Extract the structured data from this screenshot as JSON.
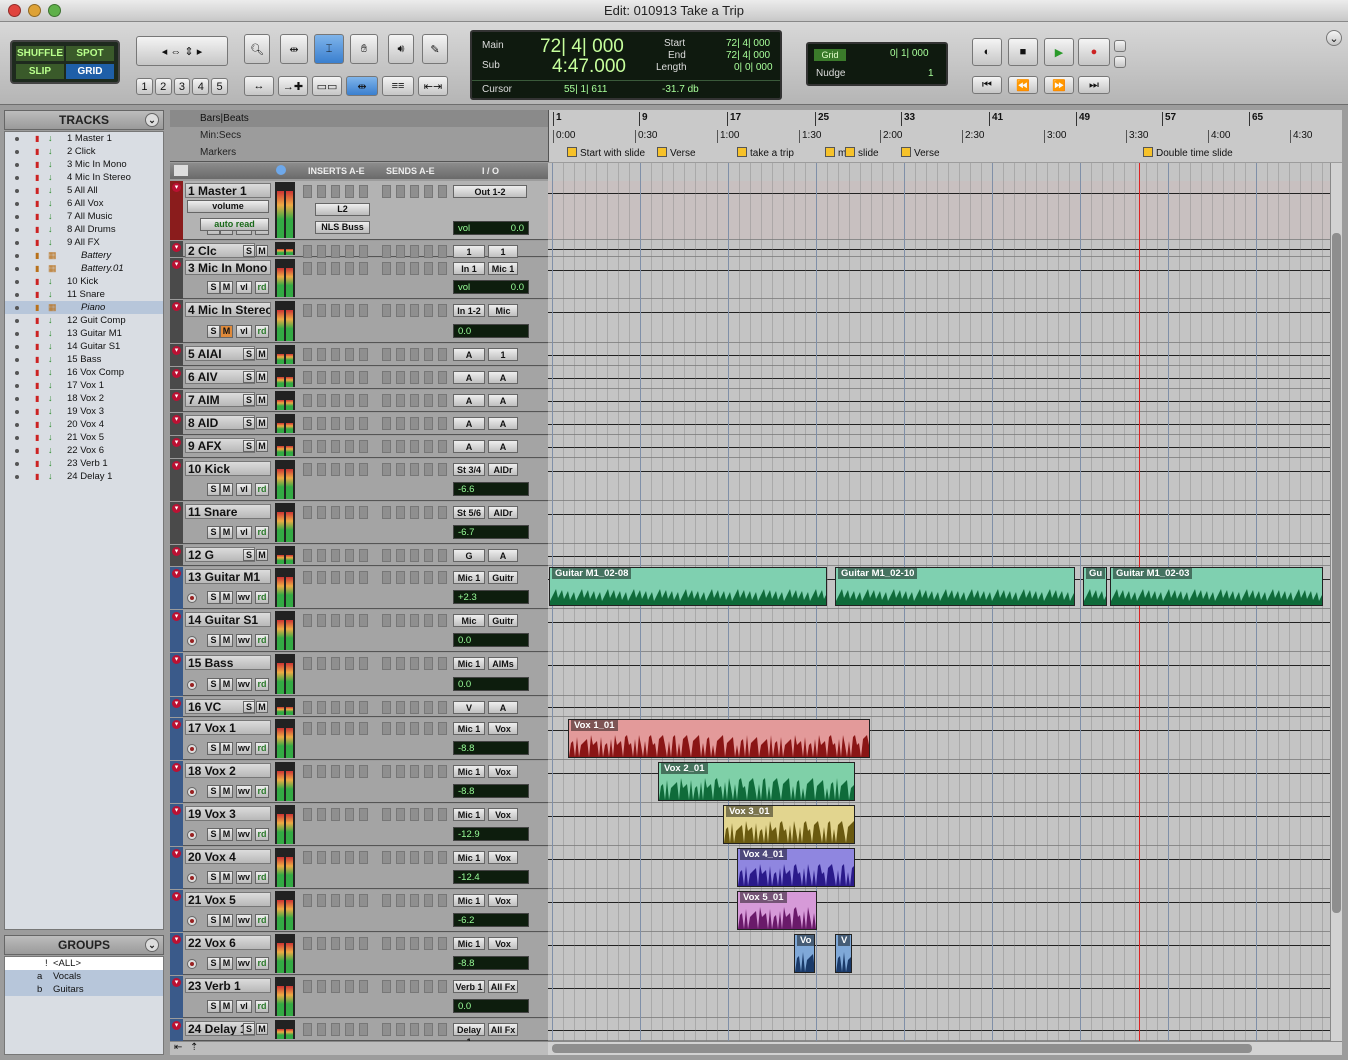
{
  "window": {
    "title": "Edit: 010913 Take a Trip"
  },
  "toolbar": {
    "modes": [
      "SHUFFLE",
      "SPOT",
      "SLIP",
      "GRID"
    ],
    "zoom_presets": [
      "1",
      "2",
      "3",
      "4",
      "5"
    ],
    "counter": {
      "main_label": "Main",
      "main_value": "72| 4| 000",
      "sub_label": "Sub",
      "sub_value": "4:47.000",
      "start_label": "Start",
      "start_value": "72| 4| 000",
      "end_label": "End",
      "end_value": "72| 4| 000",
      "length_label": "Length",
      "length_value": "0| 0| 000",
      "cursor_label": "Cursor",
      "cursor_value": "55| 1| 611",
      "level_value": "-31.7 db"
    },
    "grid": {
      "label": "Grid",
      "value": "0| 1| 000",
      "nudge_label": "Nudge",
      "nudge_value": "1"
    }
  },
  "tracks_panel": {
    "title": "TRACKS",
    "items": [
      {
        "num": "1",
        "name": "Master 1"
      },
      {
        "num": "2",
        "name": "Click"
      },
      {
        "num": "3",
        "name": "Mic In Mono"
      },
      {
        "num": "4",
        "name": "Mic In Stereo"
      },
      {
        "num": "5",
        "name": "All All"
      },
      {
        "num": "6",
        "name": "All Vox"
      },
      {
        "num": "7",
        "name": "All Music"
      },
      {
        "num": "8",
        "name": "All Drums"
      },
      {
        "num": "9",
        "name": "All FX"
      },
      {
        "num": "",
        "name": "Battery"
      },
      {
        "num": "",
        "name": "Battery.01"
      },
      {
        "num": "10",
        "name": "Kick"
      },
      {
        "num": "11",
        "name": "Snare"
      },
      {
        "num": "",
        "name": "Piano"
      },
      {
        "num": "12",
        "name": "Guit Comp"
      },
      {
        "num": "13",
        "name": "Guitar M1"
      },
      {
        "num": "14",
        "name": "Guitar S1"
      },
      {
        "num": "15",
        "name": "Bass"
      },
      {
        "num": "16",
        "name": "Vox Comp"
      },
      {
        "num": "17",
        "name": "Vox 1"
      },
      {
        "num": "18",
        "name": "Vox 2"
      },
      {
        "num": "19",
        "name": "Vox 3"
      },
      {
        "num": "20",
        "name": "Vox 4"
      },
      {
        "num": "21",
        "name": "Vox 5"
      },
      {
        "num": "22",
        "name": "Vox 6"
      },
      {
        "num": "23",
        "name": "Verb 1"
      },
      {
        "num": "24",
        "name": "Delay 1"
      }
    ]
  },
  "groups_panel": {
    "title": "GROUPS",
    "items": [
      {
        "id": "!",
        "name": "<ALL>"
      },
      {
        "id": "a",
        "name": "Vocals"
      },
      {
        "id": "b",
        "name": "Guitars"
      }
    ]
  },
  "ruler": {
    "bars_label": "Bars|Beats",
    "minsecs_label": "Min:Secs",
    "markers_label": "Markers",
    "bars": [
      "1",
      "9",
      "17",
      "25",
      "33",
      "41",
      "49",
      "57",
      "65"
    ],
    "times": [
      "0:00",
      "0:30",
      "1:00",
      "1:30",
      "2:00",
      "2:30",
      "3:00",
      "3:30",
      "4:00",
      "4:30"
    ],
    "markers": [
      "Start with slide",
      "Verse",
      "take a trip",
      "mm",
      "slide",
      "Verse",
      "Double time slide"
    ]
  },
  "columns": {
    "inserts": "INSERTS A-E",
    "sends": "SENDS A-E",
    "io": "I / O"
  },
  "tracks": [
    {
      "name": "1   Master 1",
      "in": "Out 1-2",
      "out": "",
      "vol": "vol",
      "volv": "0.0",
      "mode": "volume",
      "auto": "auto read",
      "ins1": "L2",
      "ins2": "NLS Buss"
    },
    {
      "name": "2 Clc",
      "in": "1",
      "out": "1"
    },
    {
      "name": "3 Mic In Mono",
      "in": "In 1",
      "out": "Mic 1",
      "vol": "vol",
      "volv": "0.0"
    },
    {
      "name": "4 Mic In Stereo",
      "in": "In 1-2",
      "out": "Mic",
      "vol": "0.0"
    },
    {
      "name": "5 AIAI",
      "in": "A",
      "out": "1"
    },
    {
      "name": "6 AIV",
      "in": "A",
      "out": "A"
    },
    {
      "name": "7 AIM",
      "in": "A",
      "out": "A"
    },
    {
      "name": "8 AID",
      "in": "A",
      "out": "A"
    },
    {
      "name": "9 AFX",
      "in": "A",
      "out": "A"
    },
    {
      "name": "10       Kick",
      "in": "St 3/4",
      "out": "AlDr",
      "vol": "-6.6"
    },
    {
      "name": "11       Snare",
      "in": "St 5/6",
      "out": "AlDr",
      "vol": "-6.7"
    },
    {
      "name": "12  G",
      "in": "G",
      "out": "A"
    },
    {
      "name": "13 Guitar M1",
      "in": "Mic 1",
      "out": "Guitr",
      "vol": "+2.3"
    },
    {
      "name": "14 Guitar S1",
      "in": "Mic",
      "out": "Guitr",
      "vol": "0.0"
    },
    {
      "name": "15       Bass",
      "in": "Mic 1",
      "out": "AlMs",
      "vol": "0.0"
    },
    {
      "name": "16 VC",
      "in": "V",
      "out": "A"
    },
    {
      "name": "17    Vox 1",
      "in": "Mic 1",
      "out": "Vox",
      "vol": "-8.8"
    },
    {
      "name": "18    Vox 2",
      "in": "Mic 1",
      "out": "Vox",
      "vol": "-8.8"
    },
    {
      "name": "19    Vox 3",
      "in": "Mic 1",
      "out": "Vox",
      "vol": "-12.9"
    },
    {
      "name": "20    Vox 4",
      "in": "Mic 1",
      "out": "Vox",
      "vol": "-12.4"
    },
    {
      "name": "21    Vox 5",
      "in": "Mic 1",
      "out": "Vox",
      "vol": "-6.2"
    },
    {
      "name": "22    Vox 6",
      "in": "Mic 1",
      "out": "Vox",
      "vol": "-8.8"
    },
    {
      "name": "23       Verb 1",
      "in": "Verb 1",
      "out": "All Fx",
      "vol": "0.0"
    },
    {
      "name": "24    Delay 1",
      "in": "Delay 1",
      "out": "All Fx"
    }
  ],
  "clips": [
    {
      "name": "Guitar M1_02-08",
      "color": "#7fd0b0"
    },
    {
      "name": "Guitar M1_02-10",
      "color": "#7fd0b0"
    },
    {
      "name": "Gu",
      "color": "#7fd0b0"
    },
    {
      "name": "Guitar M1_02-03",
      "color": "#7fd0b0"
    },
    {
      "name": "Vox 1_01",
      "color": "#e39a9a"
    },
    {
      "name": "Vox 2_01",
      "color": "#7fd0a8"
    },
    {
      "name": "Vox 3_01",
      "color": "#e2d58f"
    },
    {
      "name": "Vox 4_01",
      "color": "#8f86e0"
    },
    {
      "name": "Vox 5_01",
      "color": "#d69ad8"
    },
    {
      "name": "Vo",
      "color": "#7fa8d8"
    },
    {
      "name": "V",
      "color": "#7fa8d8"
    }
  ]
}
